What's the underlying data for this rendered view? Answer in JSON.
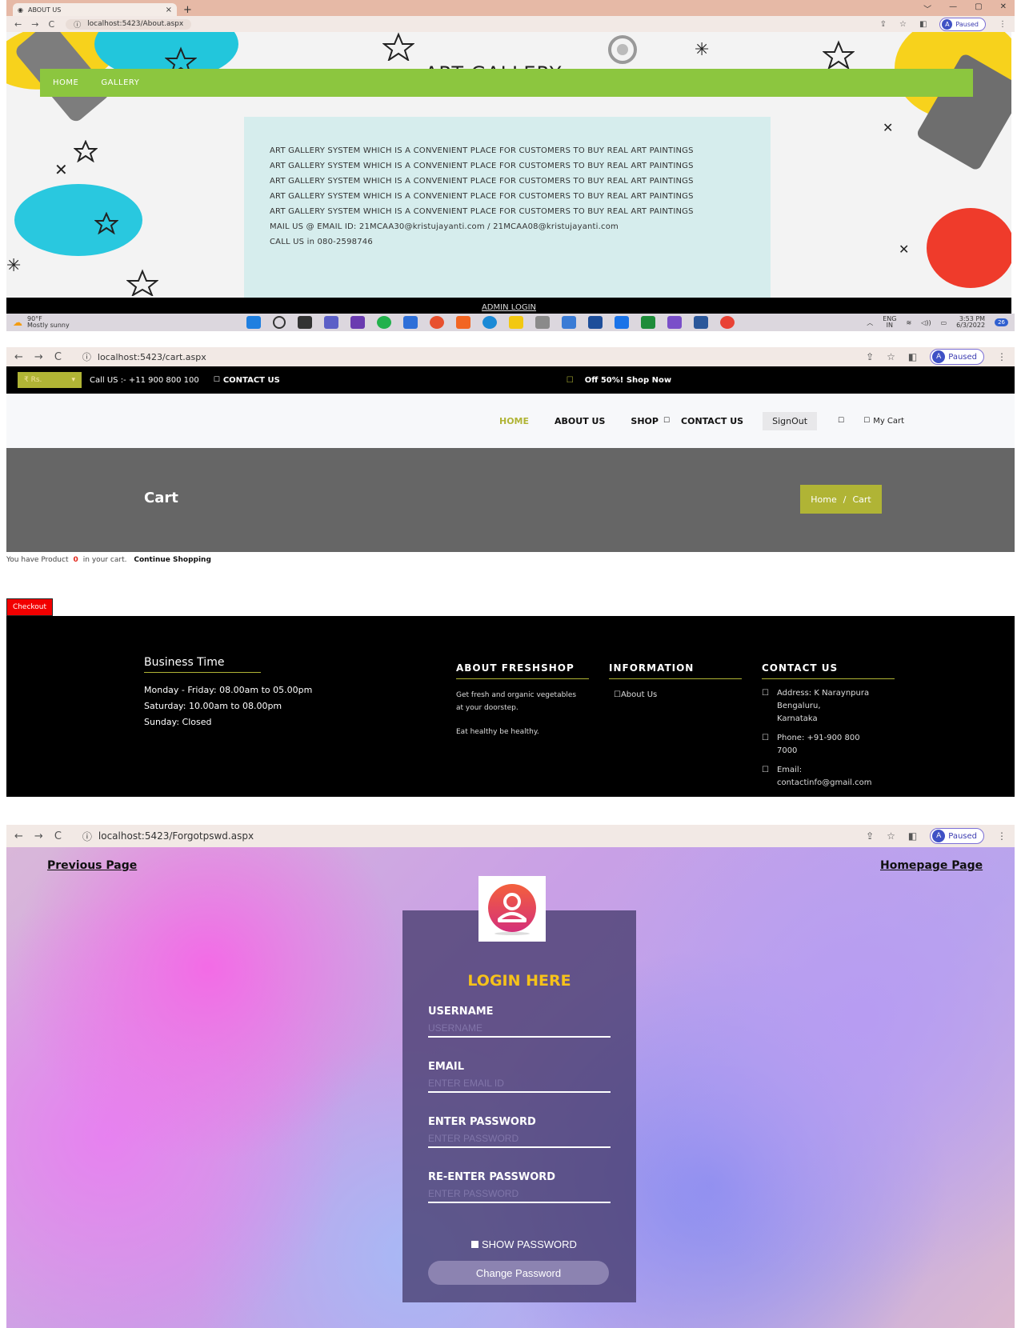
{
  "shot1": {
    "tab_title": "ABOUT US",
    "tab_close": "×",
    "new_tab": "+",
    "window_controls": [
      "﹀",
      "—",
      "▢",
      "✕"
    ],
    "nav_buttons": [
      "←",
      "→",
      "C"
    ],
    "url": "localhost:5423/About.aspx",
    "profile_initial": "A",
    "paused": "Paused",
    "site_title": "ART GALLERY",
    "nav": [
      "HOME",
      "GALLERY"
    ],
    "about_lines": [
      "ART GALLERY SYSTEM WHICH IS A CONVENIENT PLACE FOR CUSTOMERS TO BUY REAL ART PAINTINGS",
      "ART GALLERY SYSTEM WHICH IS A CONVENIENT PLACE FOR CUSTOMERS TO BUY REAL ART PAINTINGS",
      "ART GALLERY SYSTEM WHICH IS A CONVENIENT PLACE FOR CUSTOMERS TO BUY REAL ART PAINTINGS",
      "ART GALLERY SYSTEM WHICH IS A CONVENIENT PLACE FOR CUSTOMERS TO BUY REAL ART PAINTINGS",
      "ART GALLERY SYSTEM WHICH IS A CONVENIENT PLACE FOR CUSTOMERS TO BUY REAL ART PAINTINGS"
    ],
    "mail": "MAIL US @ EMAIL ID: 21MCAA30@kristujayanti.com / 21MCAA08@kristujayanti.com",
    "call": "CALL US in 080-2598746",
    "admin_login": "ADMIN LOGIN",
    "taskbar": {
      "weather_temp": "90°F",
      "weather_desc": "Mostly sunny",
      "lang": "ENG",
      "lang_region": "IN",
      "time": "3:53 PM",
      "date": "6/3/2022",
      "notif_count": "26"
    }
  },
  "shot2": {
    "nav_buttons": [
      "←",
      "→",
      "C"
    ],
    "url": "localhost:5423/cart.aspx",
    "profile_initial": "A",
    "paused": "Paused",
    "currency": "₹ Rs.",
    "call_us": "Call US :- +11 900 800 100",
    "contact_us_top": "CONTACT US",
    "offer": "Off 50%! Shop Now",
    "menu": [
      "HOME",
      "ABOUT US",
      "SHOP",
      "CONTACT US"
    ],
    "signout": "SignOut",
    "my_cart": "My Cart",
    "page_title": "Cart",
    "breadcrumb": [
      "Home",
      "Cart"
    ],
    "breadcrumb_sep": "/",
    "cart_text_before": "You have Product",
    "cart_count": "0",
    "cart_text_after": "in your cart.",
    "continue_shopping": "Continue Shopping",
    "checkout": "Checkout",
    "footer": {
      "business_title": "Business Time",
      "business_lines": [
        "Monday - Friday: 08.00am to 05.00pm",
        "Saturday: 10.00am to 08.00pm",
        "Sunday: Closed"
      ],
      "about_title": "ABOUT FRESHSHOP",
      "about_text": "Get fresh and organic vegetables at your doorstep.",
      "about_text2": "Eat healthy be healthy.",
      "info_title": "INFORMATION",
      "info_link": "About Us",
      "contact_title": "CONTACT US",
      "address": [
        "Address: K Naraynpura",
        "Bengaluru,",
        "Karnataka"
      ],
      "phone": [
        "Phone: +91-900 800",
        "7000"
      ],
      "email": [
        "Email:",
        "contactinfo@gmail.com"
      ]
    }
  },
  "shot3": {
    "nav_buttons": [
      "←",
      "→",
      "C"
    ],
    "url": "localhost:5423/Forgotpswd.aspx",
    "profile_initial": "A",
    "paused": "Paused",
    "prev_page": "Previous Page",
    "home_page": "Homepage Page",
    "login_title": "LOGIN HERE",
    "username_label": "USERNAME",
    "username_placeholder": "USERNAME",
    "email_label": "EMAIL",
    "email_placeholder": "ENTER EMAIL ID",
    "password_label": "ENTER PASSWORD",
    "password_placeholder": "ENTER PASSWORD",
    "repassword_label": "RE-ENTER PASSWORD",
    "repassword_placeholder": "ENTER PASSWORD",
    "show_password": "SHOW PASSWORD",
    "change_password": "Change Password"
  }
}
